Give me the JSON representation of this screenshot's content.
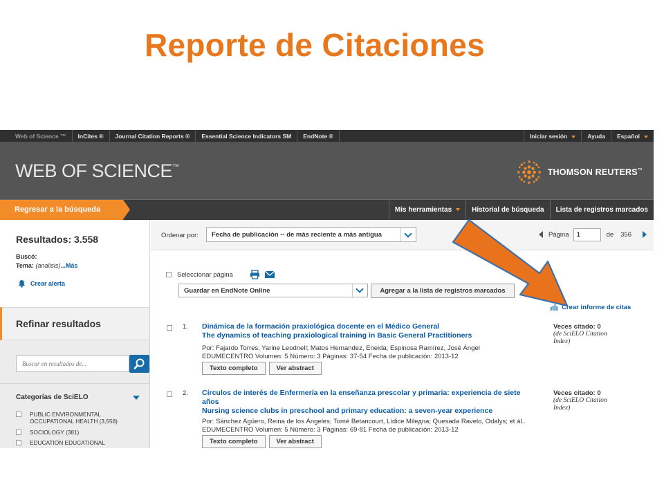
{
  "slide": {
    "title": "Reporte de Citaciones"
  },
  "topbar": {
    "left": [
      "Web of Science ™",
      "InCites ®",
      "Journal Citation Reports ®",
      "Essential Science Indicators SM",
      "EndNote ®"
    ],
    "signin": "Iniciar sesión",
    "help": "Ayuda",
    "language": "Español"
  },
  "header": {
    "logo": "WEB OF SCIENCE",
    "logo_tm": "™",
    "brand": "THOMSON REUTERS",
    "brand_tm": "™"
  },
  "navbar": {
    "back": "Regresar a la búsqueda",
    "tools": "Mis herramientas",
    "history": "Historial de búsqueda",
    "marked": "Lista de registros marcados"
  },
  "sidebar": {
    "results": "Resultados: 3.558",
    "busco": "Buscó:",
    "tema_label": "Tema:",
    "tema_query": "(analisis)",
    "mas": "...Más",
    "alert": "Crear alerta",
    "refine": "Refinar resultados",
    "search_placeholder": "Buscar en resultados de...",
    "categories_title": "Categorías de SciELO",
    "categories": [
      {
        "line1": "PUBLIC ENVIRONMENTAL",
        "line2": "OCCUPATIONAL HEALTH (3,558)"
      },
      {
        "line1": "SOCIOLOGY (381)",
        "line2": ""
      },
      {
        "line1": "EDUCATION EDUCATIONAL",
        "line2": ""
      }
    ]
  },
  "main": {
    "sort_label": "Ordenar por:",
    "sort_value": "Fecha de publicación -- de más reciente a más antigua",
    "page_label": "Página",
    "page_value": "1",
    "page_of": "de",
    "page_total": "356",
    "select_page": "Seleccionar página",
    "save_option": "Guardar en EndNote Online",
    "add_marked": "Agregar a la lista de registros marcados",
    "citation_report": "Crear informe de citas",
    "records": [
      {
        "num": "1.",
        "title_es": "Dinámica de la formación praxiológica docente en el Médico General",
        "title_en": "The dynamics of teaching praxiological training in Basic General Practitioners",
        "authors": "Por: Fajardo Torres, Yarine Leodnell; Matos Hernandez, Eneida; Espinosa Ramírez, José Ángel",
        "source": "EDUMECENTRO  Volumen: 5   Número: 3   Páginas: 37-54   Fecha de publicación: 2013-12",
        "btn_full": "Texto completo",
        "btn_abstract": "Ver abstract",
        "cited": "Veces citado: 0",
        "cited_src1": "(de SciELO Citation",
        "cited_src2": "Index)"
      },
      {
        "num": "2.",
        "title_es": "Círculos de interés de Enfermería en la enseñanza prescolar y primaria: experiencia de siete años",
        "title_en": "Nursing science clubs in preschool and primary education: a seven-year experience",
        "authors": "Por: Sánchez Agüero, Reina de los Ángeles; Tomé Betancourt, Lídice Milедna; Quesada Ravelo, Odalys; et ál..",
        "source": "EDUMECENTRO  Volumen: 5   Número: 3   Páginas: 69-81   Fecha de publicación: 2013-12",
        "btn_full": "Texto completo",
        "btn_abstract": "Ver abstract",
        "cited": "Veces citado: 0",
        "cited_src1": "(de SciELO Citation",
        "cited_src2": "Index)"
      }
    ]
  },
  "colors": {
    "accent": "#f28c28",
    "title": "#e8781e",
    "link": "#0a5aa5",
    "header": "#555555"
  }
}
